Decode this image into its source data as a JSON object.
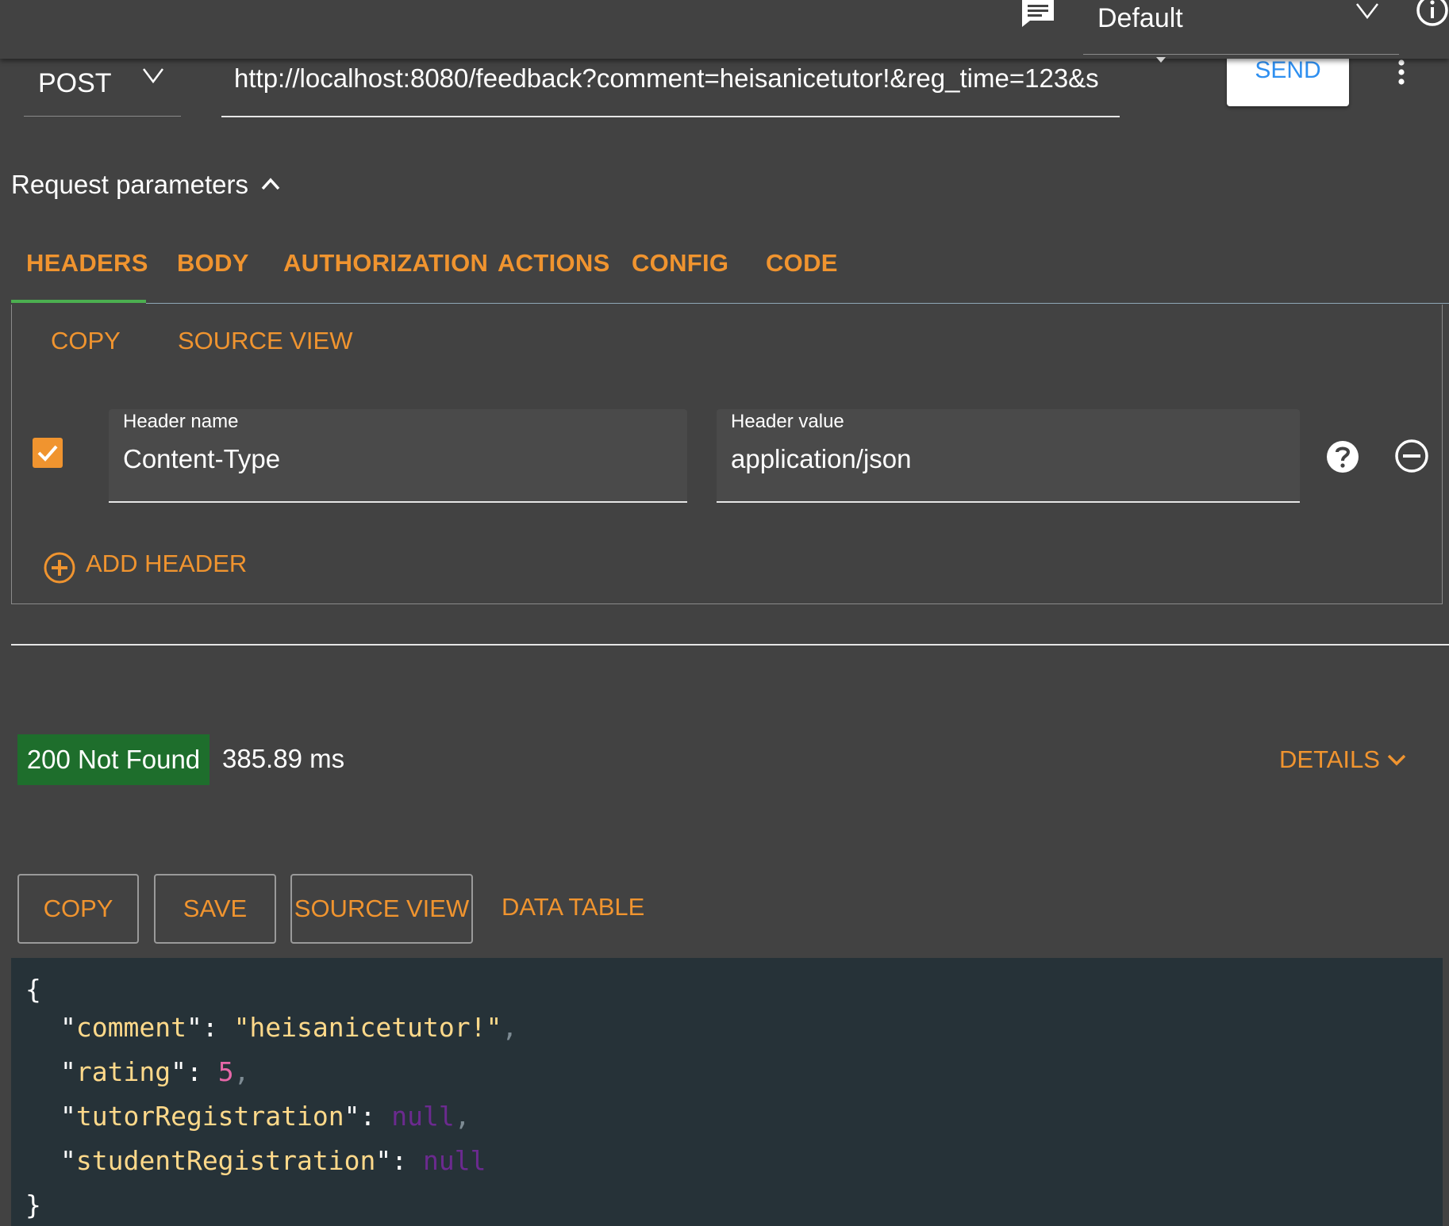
{
  "topbar": {
    "environment": "Default"
  },
  "request": {
    "method": "POST",
    "url": "http://localhost:8080/feedback?comment=heisanicetutor!&reg_time=123&s",
    "send_label": "SEND"
  },
  "params": {
    "title": "Request parameters",
    "tabs": [
      {
        "label": "HEADERS",
        "active": true
      },
      {
        "label": "BODY"
      },
      {
        "label": "AUTHORIZATION"
      },
      {
        "label": "ACTIONS"
      },
      {
        "label": "CONFIG"
      },
      {
        "label": "CODE"
      }
    ],
    "copy_label": "COPY",
    "source_view_label": "SOURCE VIEW",
    "header_row": {
      "enabled": true,
      "name_label": "Header name",
      "name_value": "Content-Type",
      "value_label": "Header value",
      "value_value": "application/json"
    },
    "add_header_label": "ADD HEADER"
  },
  "response": {
    "status": "200 Not Found",
    "time": "385.89 ms",
    "details_label": "DETAILS",
    "buttons": {
      "copy": "COPY",
      "save": "SAVE",
      "source_view": "SOURCE VIEW",
      "data_table": "DATA TABLE"
    },
    "body": {
      "open": "{",
      "close": "}",
      "fields": [
        {
          "key": "comment",
          "value": "\"heisanicetutor!\"",
          "type": "string",
          "comma": true
        },
        {
          "key": "rating",
          "value": "5",
          "type": "number",
          "comma": true
        },
        {
          "key": "tutorRegistration",
          "value": "null",
          "type": "null",
          "comma": true
        },
        {
          "key": "studentRegistration",
          "value": "null",
          "type": "null",
          "comma": false
        }
      ]
    }
  },
  "colors": {
    "accent": "#f0942f",
    "background": "#424242",
    "status_success": "#1e6e2c",
    "tab_indicator": "#4caf50",
    "send_text": "#2e8ff0",
    "code_background": "#263238"
  }
}
